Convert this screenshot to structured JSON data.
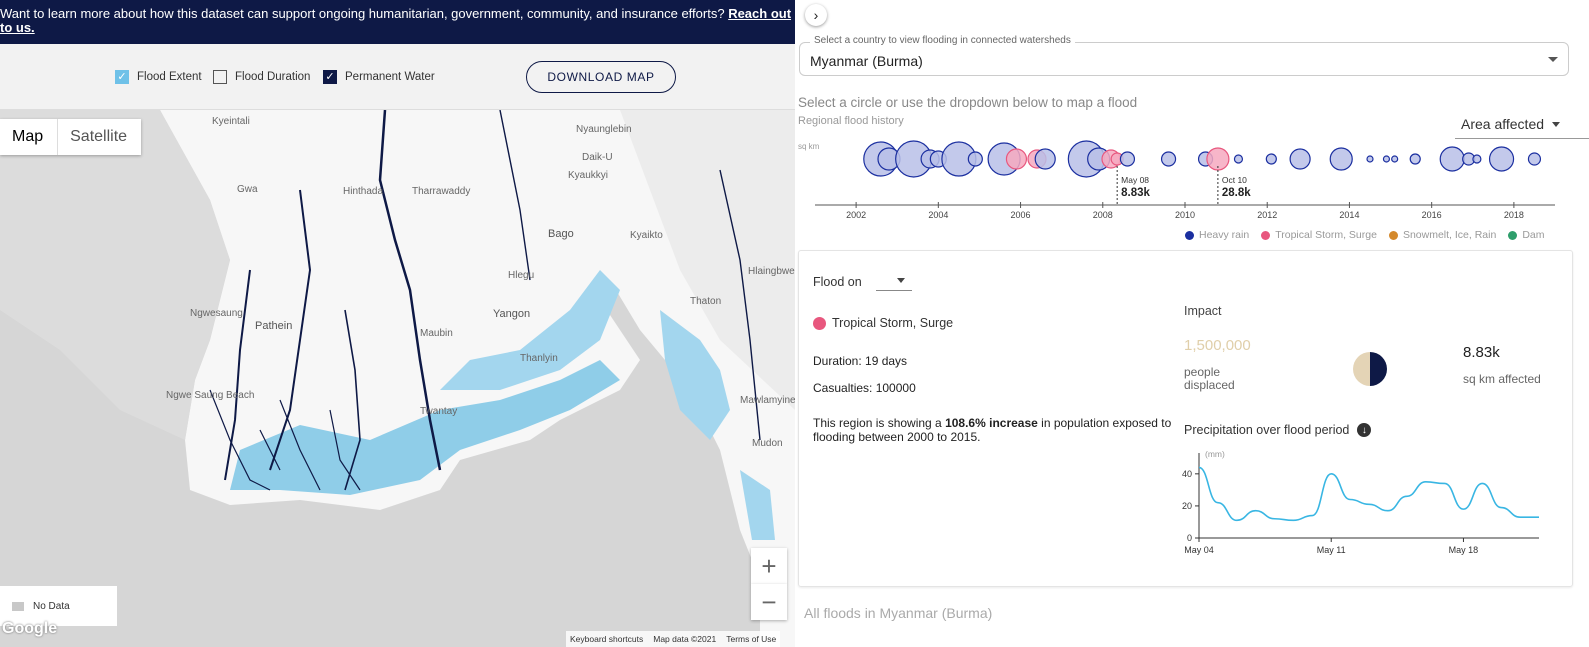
{
  "banner": {
    "text": "Want to learn more about how this dataset can support ongoing humanitarian, government, community, and insurance efforts?",
    "link": "Reach out to us."
  },
  "layers": {
    "flood_extent": {
      "label": "Flood Extent",
      "checked": true
    },
    "flood_duration": {
      "label": "Flood Duration",
      "checked": false
    },
    "permanent_water": {
      "label": "Permanent Water",
      "checked": true
    },
    "download_label": "DOWNLOAD MAP"
  },
  "map": {
    "type_options": [
      "Map",
      "Satellite"
    ],
    "selected_type": "Map",
    "places": [
      "Kyeintali",
      "Gwa",
      "Hinthada",
      "Tharrawaddy",
      "Kyaukkyi",
      "Nyaunglebin",
      "Daik-U",
      "Bago",
      "Kyaikto",
      "Hlegu",
      "Yangon",
      "Thaton",
      "Pathein",
      "Maubin",
      "Thanlyin",
      "Ngwesaung",
      "Ngwe Saung Beach",
      "Twantay",
      "Hlaingbwe",
      "Mawlamyine",
      "Mudon"
    ],
    "no_data_label": "No Data",
    "google": "Google",
    "footer": [
      "Keyboard shortcuts",
      "Map data ©2021",
      "Terms of Use"
    ],
    "zoom_in": "+",
    "zoom_out": "−"
  },
  "panel": {
    "collapse_icon": "›",
    "country_label": "Select a country to view flooding in connected watersheds",
    "country_value": "Myanmar (Burma)",
    "instruction": "Select a circle or use the dropdown below to map a flood",
    "subheading": "Regional flood history",
    "metric": "Area affected",
    "unit": "sq km",
    "annotations": [
      {
        "date": "May 08",
        "value": "8.83k"
      },
      {
        "date": "Oct 10",
        "value": "28.8k"
      }
    ],
    "years": [
      "2002",
      "2004",
      "2006",
      "2008",
      "2010",
      "2012",
      "2014",
      "2016",
      "2018"
    ],
    "causes": [
      {
        "label": "Heavy rain",
        "color": "#1b2fa0"
      },
      {
        "label": "Tropical Storm, Surge",
        "color": "#e8577e"
      },
      {
        "label": "Snowmelt, Ice, Rain",
        "color": "#d4892c"
      },
      {
        "label": "Dam",
        "color": "#2e9e6b"
      }
    ],
    "all_floods": "All floods in Myanmar (Burma)"
  },
  "detail": {
    "flood_on_label": "Flood on",
    "cause": "Tropical Storm, Surge",
    "duration": "Duration: 19 days",
    "casualties": "Casualties: 100000",
    "trend_pre": "This region is showing a ",
    "trend_bold": "108.6% increase",
    "trend_post": " in population exposed to flooding between 2000 to 2015.",
    "impact_heading": "Impact",
    "displaced_num": "1,500,000",
    "displaced_label_1": "people",
    "displaced_label_2": "displaced",
    "area_num": "8.83k",
    "area_label": "sq km affected",
    "precip_heading": "Precipitation over flood period",
    "precip_unit": "(mm)"
  },
  "chart_data": {
    "type": "line",
    "title": "Precipitation over flood period",
    "ylabel": "(mm)",
    "ylim": [
      0,
      48
    ],
    "yticks": [
      0,
      20,
      40
    ],
    "xticks": [
      "May 04",
      "May 11",
      "May 18"
    ],
    "x": [
      "May 04",
      "May 05",
      "May 06",
      "May 07",
      "May 08",
      "May 09",
      "May 10",
      "May 11",
      "May 12",
      "May 13",
      "May 14",
      "May 15",
      "May 16",
      "May 17",
      "May 18",
      "May 19",
      "May 20",
      "May 21",
      "May 22"
    ],
    "values": [
      44,
      22,
      11,
      17,
      12,
      11,
      14,
      40,
      24,
      21,
      17,
      26,
      35,
      34,
      18,
      34,
      19,
      13,
      13
    ]
  },
  "timeline_data": {
    "type": "scatter",
    "x_range": [
      2001,
      2019
    ],
    "floods": [
      {
        "year": 2002.6,
        "size": 17,
        "cause": "Heavy rain"
      },
      {
        "year": 2002.8,
        "size": 11,
        "cause": "Heavy rain"
      },
      {
        "year": 2003.4,
        "size": 18,
        "cause": "Heavy rain"
      },
      {
        "year": 2003.8,
        "size": 9,
        "cause": "Heavy rain"
      },
      {
        "year": 2004.0,
        "size": 8,
        "cause": "Heavy rain"
      },
      {
        "year": 2004.5,
        "size": 17,
        "cause": "Heavy rain"
      },
      {
        "year": 2004.9,
        "size": 7,
        "cause": "Heavy rain"
      },
      {
        "year": 2005.6,
        "size": 16,
        "cause": "Heavy rain"
      },
      {
        "year": 2005.9,
        "size": 10,
        "cause": "Tropical Storm, Surge"
      },
      {
        "year": 2006.4,
        "size": 9,
        "cause": "Tropical Storm, Surge"
      },
      {
        "year": 2006.6,
        "size": 10,
        "cause": "Heavy rain"
      },
      {
        "year": 2007.6,
        "size": 18,
        "cause": "Heavy rain"
      },
      {
        "year": 2007.9,
        "size": 11,
        "cause": "Heavy rain"
      },
      {
        "year": 2008.2,
        "size": 9,
        "cause": "Tropical Storm, Surge"
      },
      {
        "year": 2008.35,
        "size": 6,
        "cause": "Tropical Storm, Surge"
      },
      {
        "year": 2008.6,
        "size": 7,
        "cause": "Heavy rain"
      },
      {
        "year": 2009.6,
        "size": 7,
        "cause": "Heavy rain"
      },
      {
        "year": 2010.5,
        "size": 7,
        "cause": "Heavy rain"
      },
      {
        "year": 2010.8,
        "size": 11,
        "cause": "Tropical Storm, Surge"
      },
      {
        "year": 2011.3,
        "size": 4,
        "cause": "Heavy rain"
      },
      {
        "year": 2012.1,
        "size": 5,
        "cause": "Heavy rain"
      },
      {
        "year": 2012.8,
        "size": 10,
        "cause": "Heavy rain"
      },
      {
        "year": 2013.8,
        "size": 11,
        "cause": "Heavy rain"
      },
      {
        "year": 2014.5,
        "size": 3,
        "cause": "Heavy rain"
      },
      {
        "year": 2014.9,
        "size": 3,
        "cause": "Heavy rain"
      },
      {
        "year": 2015.1,
        "size": 3,
        "cause": "Heavy rain"
      },
      {
        "year": 2015.6,
        "size": 5,
        "cause": "Heavy rain"
      },
      {
        "year": 2016.5,
        "size": 12,
        "cause": "Heavy rain"
      },
      {
        "year": 2016.9,
        "size": 6,
        "cause": "Heavy rain"
      },
      {
        "year": 2017.1,
        "size": 4,
        "cause": "Heavy rain"
      },
      {
        "year": 2017.7,
        "size": 12,
        "cause": "Heavy rain"
      },
      {
        "year": 2018.5,
        "size": 6,
        "cause": "Heavy rain"
      }
    ]
  }
}
